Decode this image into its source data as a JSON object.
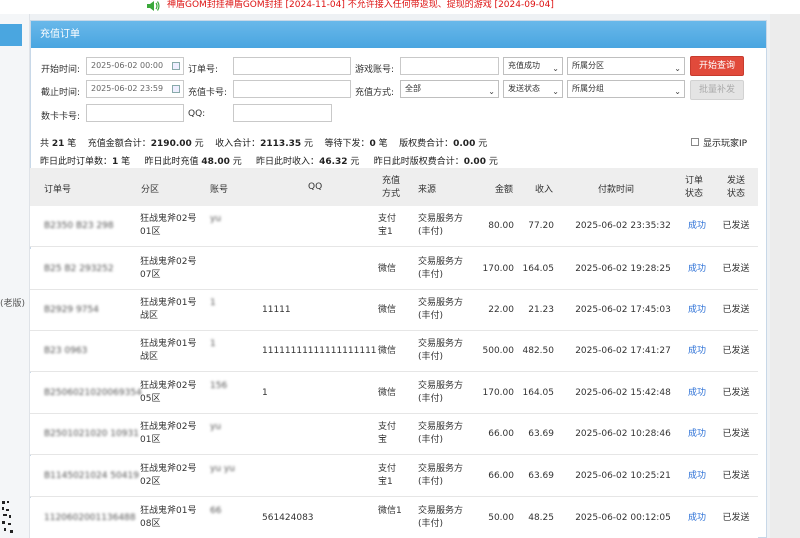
{
  "notice": "神盾GOM封挂神盾GOM封挂 [2024-11-04] 不允许接入任何带返现、提现的游戏 [2024-09-04]",
  "left_nav": {
    "partial_label": "(老版)"
  },
  "panel": {
    "title": "充值订单"
  },
  "filters": {
    "start_label": "开始时间:",
    "start_value": "2025-06-02 00:00",
    "end_label": "截止时间:",
    "end_value": "2025-06-02 23:59",
    "order_label": "订单号:",
    "order_value": "",
    "card_label": "充值卡号:",
    "card_value": "",
    "account_label": "游戏账号:",
    "account_value": "",
    "method_label": "充值方式:",
    "method_value": "全部",
    "cardno_label": "数卡卡号:",
    "cardno_value": "",
    "qq_label": "QQ:",
    "qq_value": "",
    "status_value": "充值成功",
    "send_status_value": "发送状态",
    "zone_value": "所属分区",
    "group_value": "所属分组",
    "search_button": "开始查询",
    "batch_button": "批量补发"
  },
  "summary": {
    "line1": {
      "total_prefix": "共",
      "total_count": "21",
      "total_unit": "笔",
      "amount_label": "充值金额合计：",
      "amount_value": "2190.00",
      "amount_unit": "元",
      "income_label": "收入合计：",
      "income_value": "2113.35",
      "income_unit": "元",
      "pending_label": "等待下发：",
      "pending_value": "0",
      "pending_unit": "笔",
      "royalty_label": "版权费合计：",
      "royalty_value": "0.00",
      "royalty_unit": "元"
    },
    "line2": {
      "y_orders_label": "昨日此时订单数：",
      "y_orders_value": "1",
      "y_orders_unit": "笔",
      "y_recharge_label": "昨日此时充值",
      "y_recharge_value": "48.00",
      "y_recharge_unit": "元",
      "y_income_label": "昨日此时收入：",
      "y_income_value": "46.32",
      "y_income_unit": "元",
      "y_royalty_label": "昨日此时版权费合计：",
      "y_royalty_value": "0.00",
      "y_royalty_unit": "元"
    },
    "show_ip_label": "显示玩家IP"
  },
  "table": {
    "headers": [
      "订单号",
      "分区",
      "账号",
      "QQ",
      "充值方式",
      "来源",
      "金额",
      "收入",
      "付款时间",
      "订单状态",
      "发送状态"
    ],
    "rows": [
      {
        "order": "B2350 B23 298",
        "zone": "狂战鬼斧02号01区",
        "account": "yu",
        "qq": "",
        "method": "支付宝1",
        "source": "交易服务方(丰付)",
        "amount": "80.00",
        "income": "77.20",
        "time": "2025-06-02 23:35:32",
        "status": "成功",
        "send": "已发送"
      },
      {
        "order": "B25 B2 293252",
        "zone": "狂战鬼斧02号07区",
        "account": "",
        "qq": "",
        "method": "微信",
        "source": "交易服务方(丰付)",
        "amount": "170.00",
        "income": "164.05",
        "time": "2025-06-02 19:28:25",
        "status": "成功",
        "send": "已发送"
      },
      {
        "order": "B2929 9754",
        "zone": "狂战鬼斧01号战区",
        "account": "1",
        "qq": "11111",
        "method": "微信",
        "source": "交易服务方(丰付)",
        "amount": "22.00",
        "income": "21.23",
        "time": "2025-06-02 17:45:03",
        "status": "成功",
        "send": "已发送"
      },
      {
        "order": "B23 0963",
        "zone": "狂战鬼斧01号战区",
        "account": "1",
        "qq": "11111111111111111111",
        "method": "微信",
        "source": "交易服务方(丰付)",
        "amount": "500.00",
        "income": "482.50",
        "time": "2025-06-02 17:41:27",
        "status": "成功",
        "send": "已发送"
      },
      {
        "order": "B2506021020069354",
        "zone": "狂战鬼斧02号05区",
        "account": "156",
        "qq": "1",
        "method": "微信",
        "source": "交易服务方(丰付)",
        "amount": "170.00",
        "income": "164.05",
        "time": "2025-06-02 15:42:48",
        "status": "成功",
        "send": "已发送"
      },
      {
        "order": "B2501021020 10931",
        "zone": "狂战鬼斧02号01区",
        "account": "yu",
        "qq": "",
        "method": "支付宝",
        "source": "交易服务方(丰付)",
        "amount": "66.00",
        "income": "63.69",
        "time": "2025-06-02 10:28:46",
        "status": "成功",
        "send": "已发送"
      },
      {
        "order": "B1145021024 50419",
        "zone": "狂战鬼斧02号02区",
        "account": "yu yu",
        "qq": "",
        "method": "支付宝1",
        "source": "交易服务方(丰付)",
        "amount": "66.00",
        "income": "63.69",
        "time": "2025-06-02 10:25:21",
        "status": "成功",
        "send": "已发送"
      },
      {
        "order": "1120602001136488",
        "zone": "狂战鬼斧01号08区",
        "account": "66",
        "qq": "561424083",
        "method": "微信1",
        "source": "交易服务方(丰付)",
        "amount": "50.00",
        "income": "48.25",
        "time": "2025-06-02 00:12:05",
        "status": "成功",
        "send": "已发送"
      }
    ]
  },
  "colors": {
    "header_blue": "#4aa6e0",
    "search_red": "#e14a3b",
    "status_blue": "#2a6fd6",
    "notice_red": "#dd1111"
  }
}
